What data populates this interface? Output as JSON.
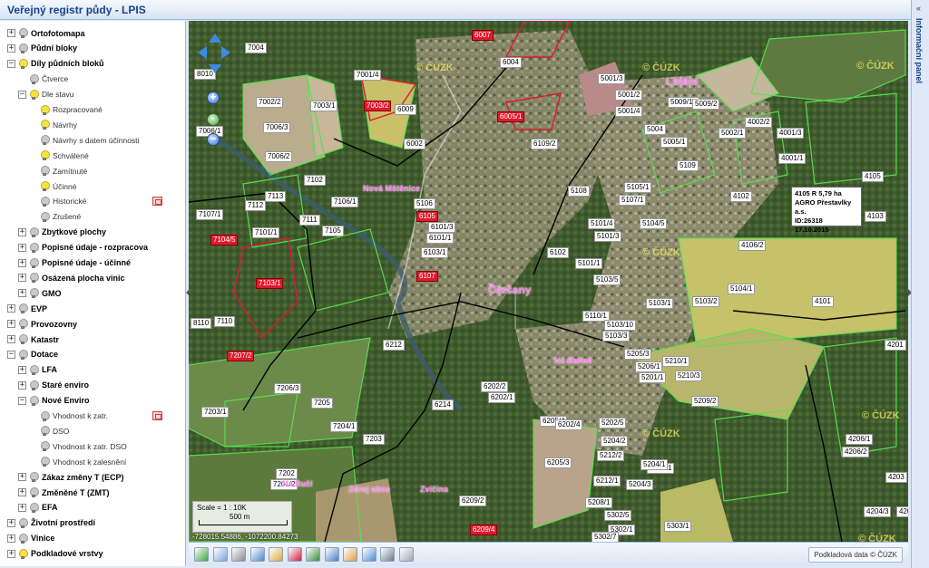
{
  "app": {
    "title": "Veřejný registr půdy - LPIS"
  },
  "right_panel": {
    "title": "Informační panel",
    "collapse_glyph": "«"
  },
  "layers": [
    {
      "label": "Ortofotomapa",
      "toggle": "+",
      "bulb": "#c9c9c9",
      "bold": true
    },
    {
      "label": "Půdní bloky",
      "toggle": "+",
      "bulb": "#c9c9c9",
      "bold": true
    },
    {
      "label": "Díly půdních bloků",
      "toggle": "−",
      "bulb": "#f5e342",
      "bold": true
    },
    {
      "label": "Čtverce",
      "toggle": "",
      "bulb": "#c9c9c9",
      "bold": false
    },
    {
      "label": "Dle stavu",
      "toggle": "−",
      "bulb": "#f5e342",
      "bold": false
    },
    {
      "label": "Rozpracované",
      "toggle": "",
      "bulb": "#f5e342",
      "bold": false
    },
    {
      "label": "Návrhy",
      "toggle": "",
      "bulb": "#f5e342",
      "bold": false
    },
    {
      "label": "Návrhy s datem účinnosti",
      "toggle": "",
      "bulb": "#c9c9c9",
      "bold": false
    },
    {
      "label": "Schválené",
      "toggle": "",
      "bulb": "#f5e342",
      "bold": false
    },
    {
      "label": "Zamítnuté",
      "toggle": "",
      "bulb": "#c9c9c9",
      "bold": false
    },
    {
      "label": "Účinné",
      "toggle": "",
      "bulb": "#f5e342",
      "bold": false
    },
    {
      "label": "Historické",
      "toggle": "",
      "bulb": "#c9c9c9",
      "bold": false,
      "legend": true
    },
    {
      "label": "Zrušené",
      "toggle": "",
      "bulb": "#c9c9c9",
      "bold": false
    },
    {
      "label": "Zbytkové plochy",
      "toggle": "+",
      "bulb": "#c9c9c9",
      "bold": true
    },
    {
      "label": "Popisné údaje - rozpracova",
      "toggle": "+",
      "bulb": "#c9c9c9",
      "bold": true
    },
    {
      "label": "Popisné údaje - účinné",
      "toggle": "+",
      "bulb": "#c9c9c9",
      "bold": true
    },
    {
      "label": "Osázená plocha vinic",
      "toggle": "+",
      "bulb": "#c9c9c9",
      "bold": true
    },
    {
      "label": "GMO",
      "toggle": "+",
      "bulb": "#c9c9c9",
      "bold": true
    },
    {
      "label": "EVP",
      "toggle": "+",
      "bulb": "#c9c9c9",
      "bold": true
    },
    {
      "label": "Provozovny",
      "toggle": "+",
      "bulb": "#c9c9c9",
      "bold": true
    },
    {
      "label": "Katastr",
      "toggle": "+",
      "bulb": "#c9c9c9",
      "bold": true
    },
    {
      "label": "Dotace",
      "toggle": "−",
      "bulb": "#c9c9c9",
      "bold": true
    },
    {
      "label": "LFA",
      "toggle": "+",
      "bulb": "#c9c9c9",
      "bold": true
    },
    {
      "label": "Staré enviro",
      "toggle": "+",
      "bulb": "#c9c9c9",
      "bold": true
    },
    {
      "label": "Nové Enviro",
      "toggle": "−",
      "bulb": "#c9c9c9",
      "bold": true
    },
    {
      "label": "Vhodnost k zatr.",
      "toggle": "",
      "bulb": "#c9c9c9",
      "bold": false,
      "legend": true
    },
    {
      "label": "DSO",
      "toggle": "",
      "bulb": "#c9c9c9",
      "bold": false
    },
    {
      "label": "Vhodnost k zatr. DSO",
      "toggle": "",
      "bulb": "#c9c9c9",
      "bold": false
    },
    {
      "label": "Vhodnost k zalesnění",
      "toggle": "",
      "bulb": "#c9c9c9",
      "bold": false
    },
    {
      "label": "Zákaz změny T (ECP)",
      "toggle": "+",
      "bulb": "#c9c9c9",
      "bold": true
    },
    {
      "label": "Změněné T (ZMT)",
      "toggle": "+",
      "bulb": "#c9c9c9",
      "bold": true
    },
    {
      "label": "EFA",
      "toggle": "+",
      "bulb": "#c9c9c9",
      "bold": true
    },
    {
      "label": "Životní prostředí",
      "toggle": "+",
      "bulb": "#c9c9c9",
      "bold": true
    },
    {
      "label": "Vinice",
      "toggle": "+",
      "bulb": "#c9c9c9",
      "bold": true
    },
    {
      "label": "Podkladové vrstvy",
      "toggle": "+",
      "bulb": "#f5e342",
      "bold": true
    }
  ],
  "map": {
    "places": [
      {
        "name": "Lštění",
        "big": true
      },
      {
        "name": "Nová Mštěnice",
        "big": false
      },
      {
        "name": "Čerčany",
        "big": true
      },
      {
        "name": "Na Bahně",
        "big": false
      },
      {
        "name": "Zvíčina",
        "big": false
      },
      {
        "name": "Na Bučí",
        "big": false
      },
      {
        "name": "Zdroj obce",
        "big": false
      }
    ],
    "parcels": [
      {
        "id": "7004",
        "red": false
      },
      {
        "id": "6007",
        "red": true
      },
      {
        "id": "6004",
        "red": false
      },
      {
        "id": "8010",
        "red": false
      },
      {
        "id": "7001/4",
        "red": false
      },
      {
        "id": "5001/3",
        "red": false
      },
      {
        "id": "5001/2",
        "red": false
      },
      {
        "id": "7002/2",
        "red": false
      },
      {
        "id": "7003/1",
        "red": false
      },
      {
        "id": "7003/2",
        "red": true
      },
      {
        "id": "6009",
        "red": false
      },
      {
        "id": "6005/1",
        "red": true
      },
      {
        "id": "5001/4",
        "red": false
      },
      {
        "id": "5009/10",
        "red": false
      },
      {
        "id": "5009/2",
        "red": false
      },
      {
        "id": "4002/2",
        "red": false
      },
      {
        "id": "7006/1",
        "red": false
      },
      {
        "id": "7006/3",
        "red": false
      },
      {
        "id": "6002",
        "red": false
      },
      {
        "id": "6109/2",
        "red": false
      },
      {
        "id": "5004",
        "red": false
      },
      {
        "id": "5005/1",
        "red": false
      },
      {
        "id": "5002/1",
        "red": false
      },
      {
        "id": "4001/3",
        "red": false
      },
      {
        "id": "7006/2",
        "red": false
      },
      {
        "id": "5109",
        "red": false
      },
      {
        "id": "4001/1",
        "red": false
      },
      {
        "id": "7102",
        "red": false
      },
      {
        "id": "5108",
        "red": false
      },
      {
        "id": "5105/1",
        "red": false
      },
      {
        "id": "4105",
        "red": false
      },
      {
        "id": "7113",
        "red": false
      },
      {
        "id": "7106/1",
        "red": false
      },
      {
        "id": "5106",
        "red": false
      },
      {
        "id": "5107/1",
        "red": false
      },
      {
        "id": "4102",
        "red": false
      },
      {
        "id": "7107/1",
        "red": false
      },
      {
        "id": "7112",
        "red": false
      },
      {
        "id": "7111",
        "red": false
      },
      {
        "id": "6105",
        "red": true
      },
      {
        "id": "5101/4",
        "red": false
      },
      {
        "id": "4103",
        "red": false
      },
      {
        "id": "7101/1",
        "red": false
      },
      {
        "id": "7105",
        "red": false
      },
      {
        "id": "6101/3",
        "red": false
      },
      {
        "id": "6101/1",
        "red": false
      },
      {
        "id": "5101/3",
        "red": false
      },
      {
        "id": "5104/5",
        "red": false
      },
      {
        "id": "4106/2",
        "red": false
      },
      {
        "id": "7104/5",
        "red": true
      },
      {
        "id": "6103/1",
        "red": false
      },
      {
        "id": "6102",
        "red": false
      },
      {
        "id": "5101/1",
        "red": false
      },
      {
        "id": "7103/1",
        "red": true
      },
      {
        "id": "6107",
        "red": true
      },
      {
        "id": "5103/5",
        "red": false
      },
      {
        "id": "5104/1",
        "red": false
      },
      {
        "id": "5103/1",
        "red": false
      },
      {
        "id": "5103/2",
        "red": false
      },
      {
        "id": "4101",
        "red": false
      },
      {
        "id": "8110",
        "red": false
      },
      {
        "id": "7110",
        "red": false
      },
      {
        "id": "5110/1",
        "red": false
      },
      {
        "id": "5103/10",
        "red": false
      },
      {
        "id": "5103/3",
        "red": false
      },
      {
        "id": "6212",
        "red": false
      },
      {
        "id": "7207/2",
        "red": true
      },
      {
        "id": "5205/3",
        "red": false
      },
      {
        "id": "5206/1",
        "red": false
      },
      {
        "id": "5210/1",
        "red": false
      },
      {
        "id": "5201/1",
        "red": false
      },
      {
        "id": "5210/3",
        "red": false
      },
      {
        "id": "4201",
        "red": false
      },
      {
        "id": "7206/3",
        "red": false
      },
      {
        "id": "6202/2",
        "red": false
      },
      {
        "id": "6202/1",
        "red": false
      },
      {
        "id": "5209/2",
        "red": false
      },
      {
        "id": "7205",
        "red": false
      },
      {
        "id": "6214",
        "red": false
      },
      {
        "id": "7203/1",
        "red": false
      },
      {
        "id": "6205/4",
        "red": false
      },
      {
        "id": "6202/4",
        "red": false
      },
      {
        "id": "5202/5",
        "red": false
      },
      {
        "id": "7204/1",
        "red": false
      },
      {
        "id": "7203",
        "red": false
      },
      {
        "id": "5204/2",
        "red": false
      },
      {
        "id": "4206/1",
        "red": false
      },
      {
        "id": "4206/2",
        "red": false
      },
      {
        "id": "6205/3",
        "red": false
      },
      {
        "id": "5212/2",
        "red": false
      },
      {
        "id": "5205/1",
        "red": false
      },
      {
        "id": "5204/1",
        "red": false
      },
      {
        "id": "7202",
        "red": false
      },
      {
        "id": "6212/1",
        "red": false
      },
      {
        "id": "4203",
        "red": false
      },
      {
        "id": "7201/2",
        "red": false
      },
      {
        "id": "5204/3",
        "red": false
      },
      {
        "id": "6209/2",
        "red": false
      },
      {
        "id": "5208/1",
        "red": false
      },
      {
        "id": "5302/5",
        "red": false
      },
      {
        "id": "4204/3",
        "red": false
      },
      {
        "id": "4204/1",
        "red": false
      },
      {
        "id": "5303/1",
        "red": false
      },
      {
        "id": "6209/4",
        "red": true
      },
      {
        "id": "5302/1",
        "red": false
      },
      {
        "id": "5302/7",
        "red": false
      }
    ],
    "tooltip": [
      "4105 R 5,79 ha",
      "AGRO Přestavlky a.s.",
      "ID:26318",
      "17.10.2015"
    ],
    "watermark": "© ČÚZK",
    "scale_text": "Scale = 1 : 10K",
    "scale_bar_label": "500 m",
    "coords": "-728015.54886, -1072200.84273"
  },
  "toolbar": {
    "tools": [
      "refresh-icon",
      "print-preview-icon",
      "zoom-extent-icon",
      "pan-icon",
      "identify-icon",
      "measure-length-icon",
      "measure-area-icon",
      "layers-icon",
      "clear-icon",
      "export-icon",
      "print-icon",
      "settings-icon"
    ],
    "source_button": "Podkladová data © ČÚZK"
  },
  "colors": {
    "accent": "#15428b",
    "panel_border": "#99bbe8",
    "parcel_red": "#e0192f",
    "field_yellow": "#d8d86a"
  }
}
